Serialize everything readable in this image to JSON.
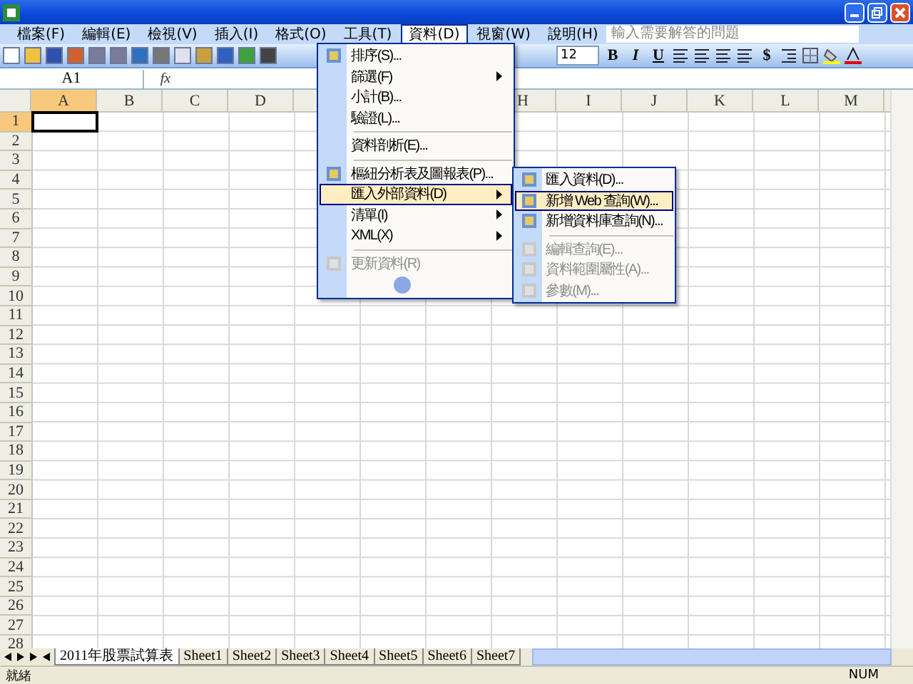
{
  "menu_bar": [
    {
      "label": "檔案(F)",
      "selected": false
    },
    {
      "label": "編輯(E)",
      "selected": false
    },
    {
      "label": "檢視(V)",
      "selected": false
    },
    {
      "label": "插入(I)",
      "selected": false
    },
    {
      "label": "格式(O)",
      "selected": false
    },
    {
      "label": "工具(T)",
      "selected": false
    },
    {
      "label": "資料(D)",
      "selected": true
    },
    {
      "label": "視窗(W)",
      "selected": false
    },
    {
      "label": "說明(H)",
      "selected": false
    }
  ],
  "help_box": {
    "placeholder": "輸入需要解答的問題"
  },
  "format_toolbar": {
    "font_size": "12",
    "bold": "B",
    "italic": "I",
    "underline": "U",
    "currency": "$"
  },
  "formula_bar": {
    "name_box": "A1",
    "function_label": "fx"
  },
  "sheet": {
    "columns_left": [
      {
        "label": "A",
        "selected": true
      },
      {
        "label": "B",
        "selected": false
      },
      {
        "label": "C",
        "selected": false
      },
      {
        "label": "D",
        "selected": false
      }
    ],
    "columns_right": [
      {
        "label": "H",
        "selected": false
      },
      {
        "label": "I",
        "selected": false
      },
      {
        "label": "J",
        "selected": false
      },
      {
        "label": "K",
        "selected": false
      },
      {
        "label": "L",
        "selected": false
      },
      {
        "label": "M",
        "selected": false
      }
    ],
    "rows": [
      {
        "label": "1",
        "selected": true
      },
      {
        "label": "2",
        "selected": false
      },
      {
        "label": "3",
        "selected": false
      },
      {
        "label": "4",
        "selected": false
      },
      {
        "label": "5",
        "selected": false
      },
      {
        "label": "6",
        "selected": false
      },
      {
        "label": "7",
        "selected": false
      },
      {
        "label": "8",
        "selected": false
      },
      {
        "label": "9",
        "selected": false
      },
      {
        "label": "10",
        "selected": false
      },
      {
        "label": "11",
        "selected": false
      },
      {
        "label": "12",
        "selected": false
      },
      {
        "label": "13",
        "selected": false
      },
      {
        "label": "14",
        "selected": false
      },
      {
        "label": "15",
        "selected": false
      },
      {
        "label": "16",
        "selected": false
      },
      {
        "label": "17",
        "selected": false
      },
      {
        "label": "18",
        "selected": false
      },
      {
        "label": "19",
        "selected": false
      },
      {
        "label": "20",
        "selected": false
      },
      {
        "label": "21",
        "selected": false
      },
      {
        "label": "22",
        "selected": false
      },
      {
        "label": "23",
        "selected": false
      },
      {
        "label": "24",
        "selected": false
      },
      {
        "label": "25",
        "selected": false
      },
      {
        "label": "26",
        "selected": false
      },
      {
        "label": "27",
        "selected": false
      },
      {
        "label": "28",
        "selected": false
      }
    ]
  },
  "data_menu": [
    {
      "kind": "item",
      "label": "排序(S)...",
      "has_icon": true,
      "arrow": false,
      "selected": false,
      "disabled": false
    },
    {
      "kind": "item",
      "label": "篩選(F)",
      "has_icon": false,
      "arrow": true,
      "selected": false,
      "disabled": false
    },
    {
      "kind": "item",
      "label": "小計(B)...",
      "has_icon": false,
      "arrow": false,
      "selected": false,
      "disabled": false
    },
    {
      "kind": "item",
      "label": "驗證(L)...",
      "has_icon": false,
      "arrow": false,
      "selected": false,
      "disabled": false
    },
    {
      "kind": "separator"
    },
    {
      "kind": "item",
      "label": "資料剖析(E)...",
      "has_icon": false,
      "arrow": false,
      "selected": false,
      "disabled": false
    },
    {
      "kind": "separator"
    },
    {
      "kind": "item",
      "label": "樞紐分析表及圖報表(P)...",
      "has_icon": true,
      "arrow": false,
      "selected": false,
      "disabled": false
    },
    {
      "kind": "item",
      "label": "匯入外部資料(D)",
      "has_icon": false,
      "arrow": true,
      "selected": true,
      "disabled": false
    },
    {
      "kind": "item",
      "label": "清單(I)",
      "has_icon": false,
      "arrow": true,
      "selected": false,
      "disabled": false
    },
    {
      "kind": "item",
      "label": "XML(X)",
      "has_icon": false,
      "arrow": true,
      "selected": false,
      "disabled": false
    },
    {
      "kind": "separator"
    },
    {
      "kind": "item",
      "label": "更新資料(R)",
      "has_icon": true,
      "arrow": false,
      "selected": false,
      "disabled": true
    },
    {
      "kind": "expand"
    }
  ],
  "import_submenu": [
    {
      "kind": "item",
      "label": "匯入資料(D)...",
      "selected": false,
      "disabled": false
    },
    {
      "kind": "item",
      "label": "新增 Web 查詢(W)...",
      "selected": true,
      "disabled": false
    },
    {
      "kind": "item",
      "label": "新增資料庫查詢(N)...",
      "selected": false,
      "disabled": false
    },
    {
      "kind": "separator"
    },
    {
      "kind": "item",
      "label": "編輯查詢(E)...",
      "selected": false,
      "disabled": true
    },
    {
      "kind": "item",
      "label": "資料範圍屬性(A)...",
      "selected": false,
      "disabled": true
    },
    {
      "kind": "item",
      "label": "參數(M)...",
      "selected": false,
      "disabled": true
    }
  ],
  "sheet_tabs": [
    {
      "label": "2011年股票試算表",
      "selected": true
    },
    {
      "label": "Sheet1",
      "selected": false
    },
    {
      "label": "Sheet2",
      "selected": false
    },
    {
      "label": "Sheet3",
      "selected": false
    },
    {
      "label": "Sheet4",
      "selected": false
    },
    {
      "label": "Sheet5",
      "selected": false
    },
    {
      "label": "Sheet6",
      "selected": false
    },
    {
      "label": "Sheet7",
      "selected": false
    }
  ],
  "status_bar": {
    "text": "就緒",
    "indicator": "NUM"
  }
}
